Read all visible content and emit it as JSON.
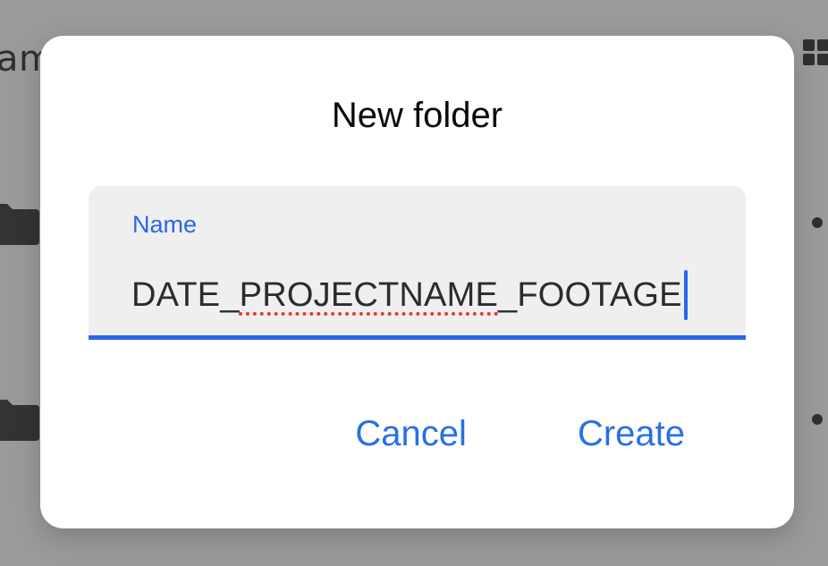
{
  "background": {
    "title_fragment": "am",
    "view_toggle_icon": "grid-view-icon",
    "row_icon": "folder-icon",
    "row_menu_icon": "dot-menu-icon"
  },
  "dialog": {
    "title": "New folder",
    "name_field": {
      "label": "Name",
      "value_prefix": "DATE_",
      "value_misspelled": "PROJECTNAME",
      "value_suffix": "_FOOTAGE",
      "caret_icon": "text-cursor"
    },
    "actions": {
      "cancel_label": "Cancel",
      "create_label": "Create"
    }
  },
  "colors": {
    "accent": "#2b66e8",
    "button_text": "#2870e6",
    "field_background": "#efefef",
    "spellcheck_underline": "#e23b32",
    "scrim": "#9a9a9a"
  }
}
